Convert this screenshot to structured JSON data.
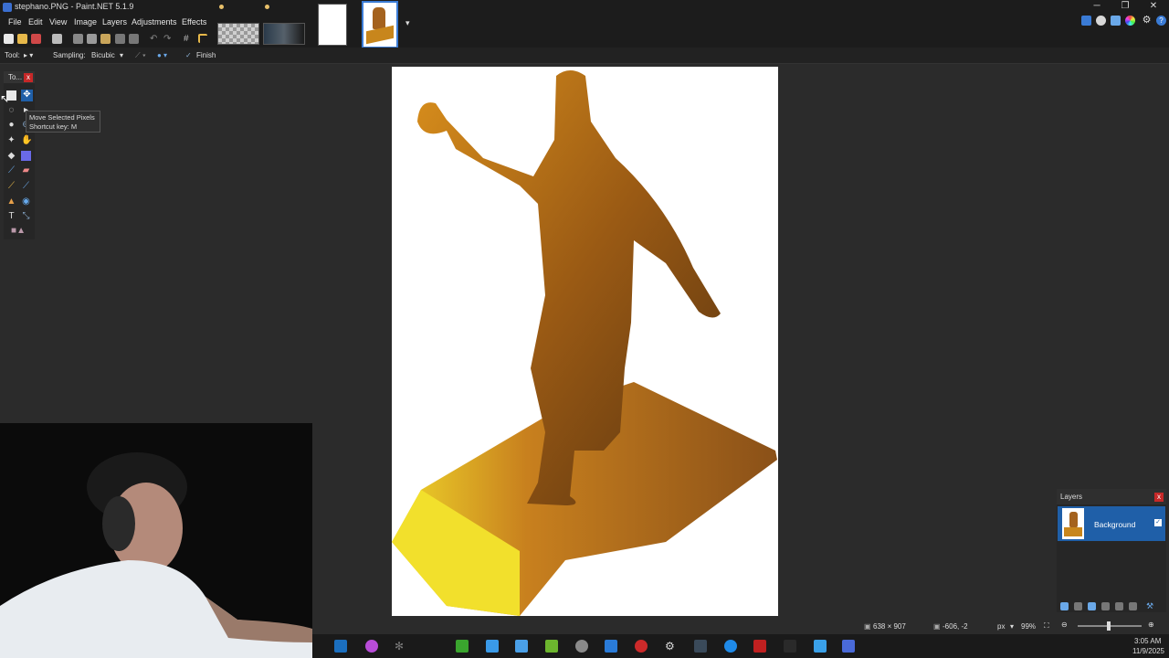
{
  "window": {
    "title": "stephano.PNG - Paint.NET 5.1.9",
    "minimize": "─",
    "restore": "❐",
    "close": "✕"
  },
  "menu": [
    "File",
    "Edit",
    "View",
    "Image",
    "Layers",
    "Adjustments",
    "Effects"
  ],
  "toolbar2": {
    "tool_label": "Tool:",
    "sampling_label": "Sampling:",
    "sampling_value": "Bicubic",
    "finish_label": "Finish"
  },
  "tools_panel": {
    "title": "To...",
    "close": "x"
  },
  "tooltip": {
    "line1": "Move Selected Pixels",
    "line2": "Shortcut key: M"
  },
  "layers_panel": {
    "title": "Layers",
    "close": "x",
    "layer_name": "Background",
    "layer_checked": "✓"
  },
  "status": {
    "image_size": "638 × 907",
    "cursor_pos": "-606, -2",
    "unit": "px",
    "zoom": "99%"
  },
  "taskbar": {
    "time": "3:05 AM",
    "date": "11/9/2025"
  },
  "colors": {
    "accent": "#1f5fa8",
    "close": "#c62828",
    "canvas": "#ffffff",
    "background": "#2b2b2b"
  }
}
